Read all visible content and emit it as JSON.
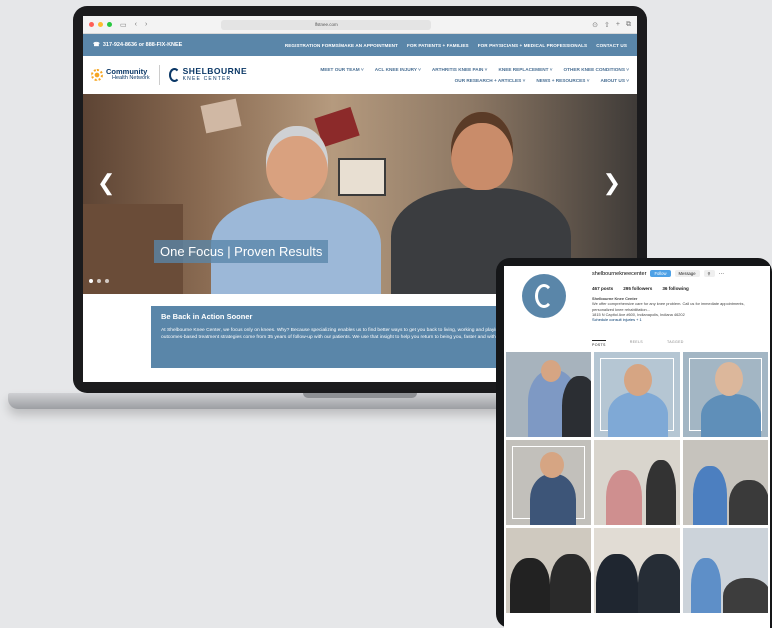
{
  "browser": {
    "url": "lfstnee.com",
    "nav_back": "‹",
    "nav_forward": "›"
  },
  "site": {
    "phone": "317-924-8636 or 888-FIX-KNEE",
    "top_nav": [
      "REGISTRATION FORMS/MAKE AN APPOINTMENT",
      "FOR PATIENTS + FAMILIES",
      "FOR PHYSICIANS + MEDICAL PROFESSIONALS",
      "CONTACT US"
    ],
    "logo_chn": {
      "line1": "Community",
      "line2": "Health Network"
    },
    "logo_skc": {
      "line1": "SHELBOURNE",
      "line2": "KNEE CENTER"
    },
    "main_nav_row1": [
      "MEET OUR TEAM ˅",
      "ACL KNEE INJURY ˅",
      "ARTHRITIS KNEE PAIN ˅",
      "KNEE REPLACEMENT ˅",
      "OTHER KNEE CONDITIONS ˅"
    ],
    "main_nav_row2": [
      "OUR RESEARCH + ARTICLES ˅",
      "NEWS + RESOURCES ˅",
      "ABOUT US ˅"
    ],
    "hero_caption": "One Focus | Proven Results",
    "arrow_left": "❮",
    "arrow_right": "❯",
    "section_title": "Be Back in Action Sooner",
    "section_text": "At Shelbourne Knee Center, we focus only on knees. Why? Because specializing enables us to find better ways to get you back to living, working and playing the way you want. Our outcomes-based treatment strategies come from 35 years of follow-up with our patients. We use that insight to help you return to being you, faster and with better long-term out"
  },
  "instagram": {
    "username": "shelbourneknеecenter",
    "follow_label": "Follow",
    "message_label": "Message",
    "more_label": "···",
    "posts": "467 posts",
    "followers": "295 followers",
    "following": "36 following",
    "bio_name": "Shelbourne Knee Center",
    "bio_text": "We offer comprehensive care for any knee problem. Call us for immediate appointments, personalized knee rehabilitation...",
    "bio_address": "1815 N Capitol Ave #600, Indianapolis, Indiana 46202",
    "bio_link": "Schedule consult injuries + 1",
    "tabs": [
      "POSTS",
      "REELS",
      "TAGGED"
    ]
  },
  "colors": {
    "brand_blue": "#5a86a9",
    "navy": "#0a3766"
  }
}
